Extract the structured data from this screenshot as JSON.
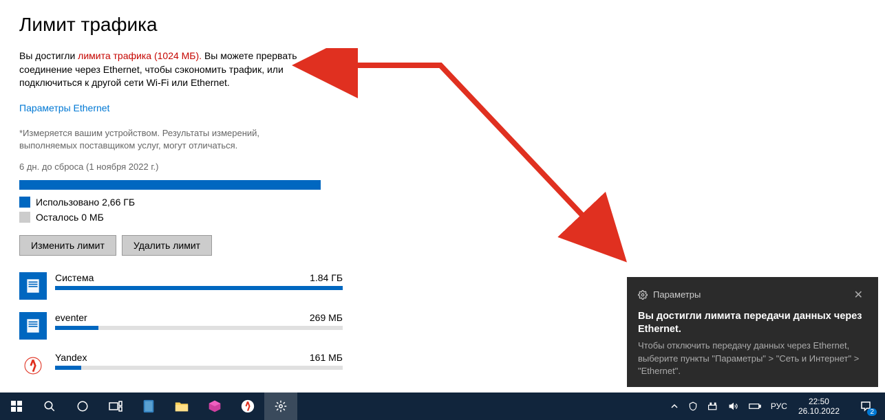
{
  "page": {
    "title": "Лимит трафика",
    "desc_prefix": "Вы достигли  ",
    "desc_red": "лимита трафика (1024 МБ).",
    "desc_suffix": "  Вы можете прервать соединение через Ethernet, чтобы сэкономить трафик, или подключиться к другой сети Wi-Fi или Ethernet.",
    "link": "Параметры Ethernet",
    "note": "*Измеряется вашим устройством. Результаты измерений, выполняемых поставщиком услуг, могут отличаться.",
    "reset": "6 дн. до сброса (1 ноября 2022 г.)",
    "used_label": "Использовано 2,66 ГБ",
    "remain_label": "Осталось 0 МБ",
    "btn_change": "Изменить лимит",
    "btn_delete": "Удалить лимит"
  },
  "apps": [
    {
      "name": "Система",
      "value": "1.84 ГБ",
      "pct": 100,
      "icon": "system"
    },
    {
      "name": "eventer",
      "value": "269 МБ",
      "pct": 15,
      "icon": "system"
    },
    {
      "name": "Yandex",
      "value": "161 МБ",
      "pct": 9,
      "icon": "yandex"
    }
  ],
  "notif": {
    "source": "Параметры",
    "title": "Вы достигли лимита передачи данных через Ethernet.",
    "body": "Чтобы отключить передачу данных через Ethernet, выберите пункты \"Параметры\" > \"Сеть и Интернет\" > \"Ethernet\"."
  },
  "taskbar": {
    "lang": "РУС",
    "time": "22:50",
    "date": "26.10.2022",
    "notif_count": "2"
  }
}
